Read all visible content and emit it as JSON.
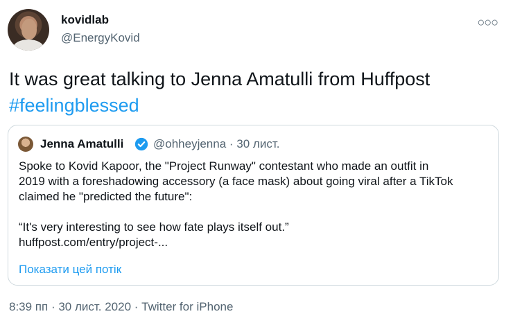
{
  "author": {
    "name": "kovidlab",
    "handle": "@EnergyKovid"
  },
  "tweet": {
    "text": "It was great talking to Jenna Amatulli from Huffpost",
    "hashtag": "#feelingblessed"
  },
  "quote": {
    "name": "Jenna Amatulli",
    "handle": "@ohheyjenna",
    "date": " · 30 лист.",
    "line1": "Spoke to Kovid Kapoor, the \"Project Runway\" contestant who made an outfit in",
    "line2": "2019 with a foreshadowing accessory (a face mask) about going viral after a TikTok",
    "line3": "claimed he \"predicted the future\":",
    "line4": "“It's very interesting to see how fate plays itself out.”",
    "line5": "huffpost.com/entry/project-...",
    "show_thread": "Показати цей потік"
  },
  "footer": {
    "meta": "8:39 пп · 30 лист. 2020 · Twitter for iPhone"
  },
  "colors": {
    "link": "#1d9bf0",
    "secondary": "#536471",
    "border": "#cfd9de"
  }
}
